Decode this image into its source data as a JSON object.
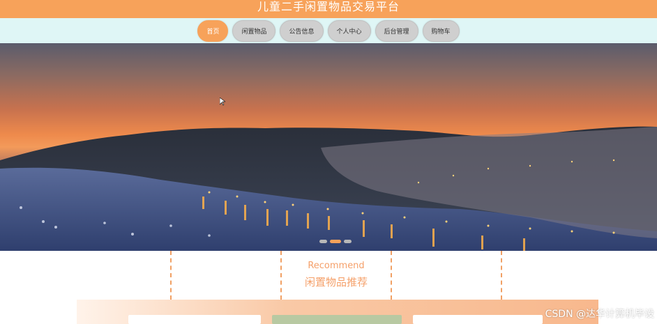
{
  "site": {
    "title": "儿童二手闲置物品交易平台"
  },
  "nav": {
    "items": [
      {
        "label": "首页"
      },
      {
        "label": "闲置物品"
      },
      {
        "label": "公告信息"
      },
      {
        "label": "个人中心"
      },
      {
        "label": "后台管理"
      },
      {
        "label": "购物车"
      }
    ],
    "active_index": 0
  },
  "carousel": {
    "slide_count": 3,
    "active_slide": 2
  },
  "recommend": {
    "title_en": "Recommend",
    "title_cn": "闲置物品推荐"
  },
  "watermark": {
    "text": "CSDN @达华计算机毕设"
  },
  "colors": {
    "accent": "#f7a25a",
    "nav_bg": "#dff6f6"
  }
}
